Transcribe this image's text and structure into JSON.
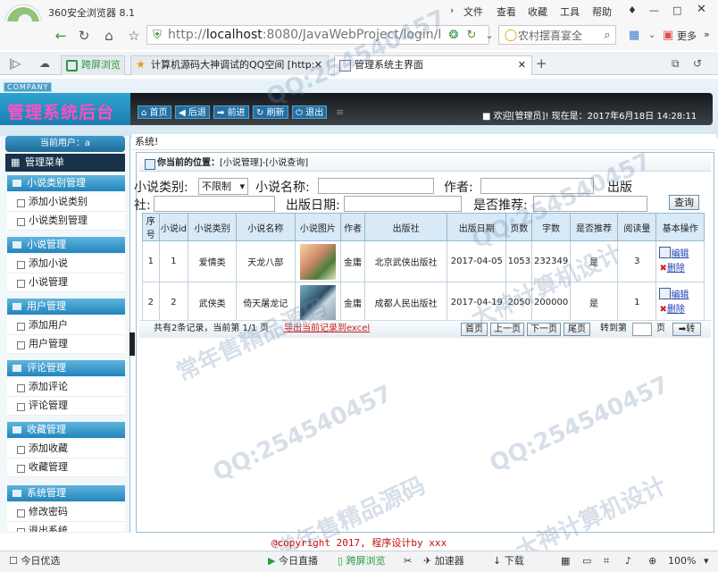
{
  "browser": {
    "app_title": "360安全浏览器 8.1",
    "top_menu": [
      "文件",
      "查看",
      "收藏",
      "工具",
      "帮助"
    ],
    "url_prefix": "http://",
    "url_host": "localhost",
    "url_rest": ":8080/JavaWebProject/login/log",
    "search_text": "农村摆喜宴全",
    "more_label": "更多",
    "tabs": [
      {
        "label": "跨屏浏览",
        "active": false
      },
      {
        "label": "计算机源码大神调试的QQ空间 [http:",
        "active": false
      },
      {
        "label": "管理系统主界面",
        "active": true
      }
    ]
  },
  "header": {
    "company_label": "COMPANY",
    "system_title": "管理系统后台",
    "nav_buttons": [
      "首页",
      "后退",
      "前进",
      "刷新",
      "退出"
    ],
    "welcome_text": "欢迎[管理员]!  现在是：2017年6月18日 14:28:11"
  },
  "sidebar": {
    "current_user_label": "当前用户：a",
    "menu_title": "管理菜单",
    "sections": [
      {
        "title": "小说类别管理",
        "items": [
          "添加小说类别",
          "小说类别管理"
        ]
      },
      {
        "title": "小说管理",
        "items": [
          "添加小说",
          "小说管理"
        ]
      },
      {
        "title": "用户管理",
        "items": [
          "添加用户",
          "用户管理"
        ]
      },
      {
        "title": "评论管理",
        "items": [
          "添加评论",
          "评论管理"
        ]
      },
      {
        "title": "收藏管理",
        "items": [
          "添加收藏",
          "收藏管理"
        ]
      },
      {
        "title": "系统管理",
        "items": [
          "修改密码",
          "退出系统"
        ]
      }
    ]
  },
  "content": {
    "top_crumb": "系统!",
    "position_label": "你当前的位置：",
    "position_path": "[小说管理]-[小说查询]",
    "filters": {
      "category_label": "小说类别:",
      "category_value": "不限制",
      "name_label": "小说名称:",
      "author_label": "作者:",
      "publisher_label_1": "出版",
      "publisher_label_2": "社:",
      "date_label": "出版日期:",
      "recommend_label": "是否推荐:",
      "query_button": "查询"
    },
    "table": {
      "headers": [
        "序号",
        "小说id",
        "小说类别",
        "小说名称",
        "小说图片",
        "作者",
        "出版社",
        "出版日期",
        "页数",
        "字数",
        "是否推荐",
        "阅读量",
        "基本操作"
      ],
      "rows": [
        {
          "no": "1",
          "id": "1",
          "category": "爱情类",
          "name": "天龙八部",
          "author": "金庸",
          "publisher": "北京武侠出版社",
          "date": "2017-04-05",
          "pages": "1053",
          "words": "232349",
          "recommend": "是",
          "reads": "3"
        },
        {
          "no": "2",
          "id": "2",
          "category": "武侠类",
          "name": "倚天屠龙记",
          "author": "金庸",
          "publisher": "成都人民出版社",
          "date": "2017-04-19",
          "pages": "2050",
          "words": "200000",
          "recommend": "是",
          "reads": "1"
        }
      ],
      "edit_label": "编辑",
      "delete_label": "删除"
    },
    "footer": {
      "summary": "共有2条记录，当前第 1/1 页",
      "export_link": "导出当前记录到excel",
      "first": "首页",
      "prev": "上一页",
      "next": "下一页",
      "last": "尾页",
      "goto_label": "转到第",
      "page_unit": "页",
      "go_button": "转"
    }
  },
  "copyright": "@copyright 2017, 程序设计by xxx",
  "statusbar": {
    "left_item": "今日优选",
    "items": [
      "今日直播",
      "跨屏浏览",
      "加速器",
      "下载"
    ],
    "zoom": "100%"
  },
  "watermarks": [
    "QQ:254540457",
    "大神计算机设计",
    "常年售精品源码"
  ]
}
